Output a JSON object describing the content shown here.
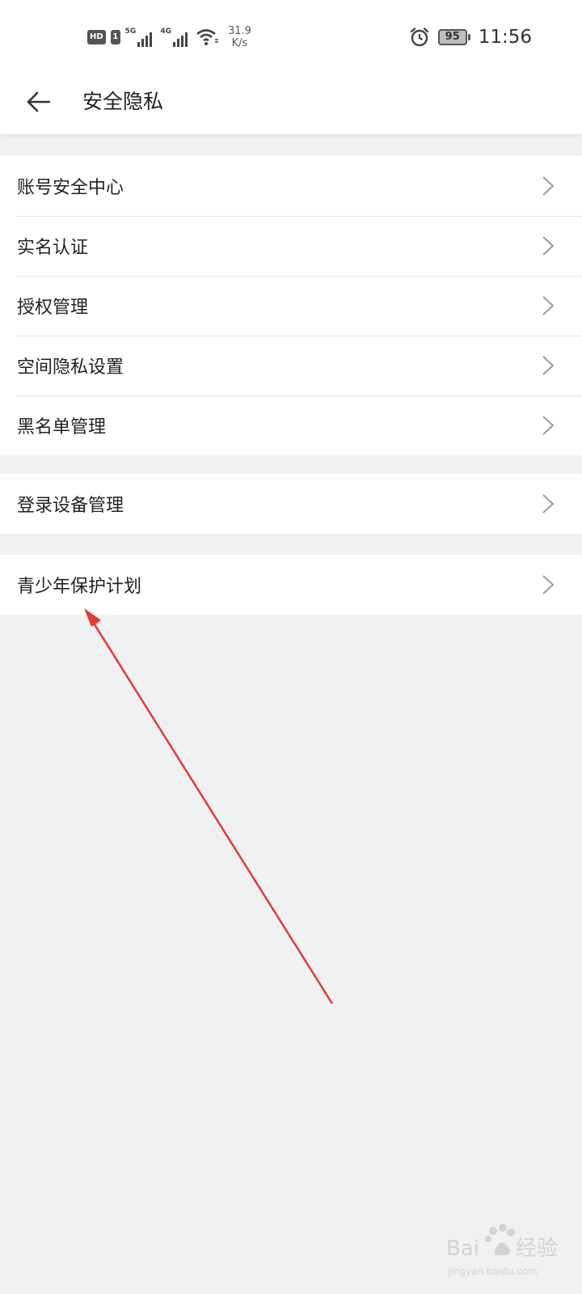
{
  "status_bar": {
    "hd": "HD",
    "sim": "1",
    "net1": "5G",
    "net2": "4G",
    "speed_value": "31.9",
    "speed_unit": "K/s",
    "battery": "95",
    "time": "11:56",
    "icons": [
      "hd-icon",
      "signal-icon",
      "wifi-icon",
      "alarm-icon",
      "battery-icon"
    ]
  },
  "header": {
    "title": "安全隐私",
    "back_icon": "arrow-left-icon"
  },
  "groups": [
    {
      "items": [
        {
          "label": "账号安全中心"
        },
        {
          "label": "实名认证"
        },
        {
          "label": "授权管理"
        },
        {
          "label": "空间隐私设置"
        },
        {
          "label": "黑名单管理"
        }
      ]
    },
    {
      "items": [
        {
          "label": "登录设备管理"
        }
      ]
    },
    {
      "items": [
        {
          "label": "青少年保护计划"
        }
      ]
    }
  ],
  "colors": {
    "background": "#f0f1f3",
    "surface": "#ffffff",
    "annotation": "#e53935"
  },
  "watermark": {
    "text": "Baidu经验",
    "url_text": "jingyan.baidu.com"
  }
}
